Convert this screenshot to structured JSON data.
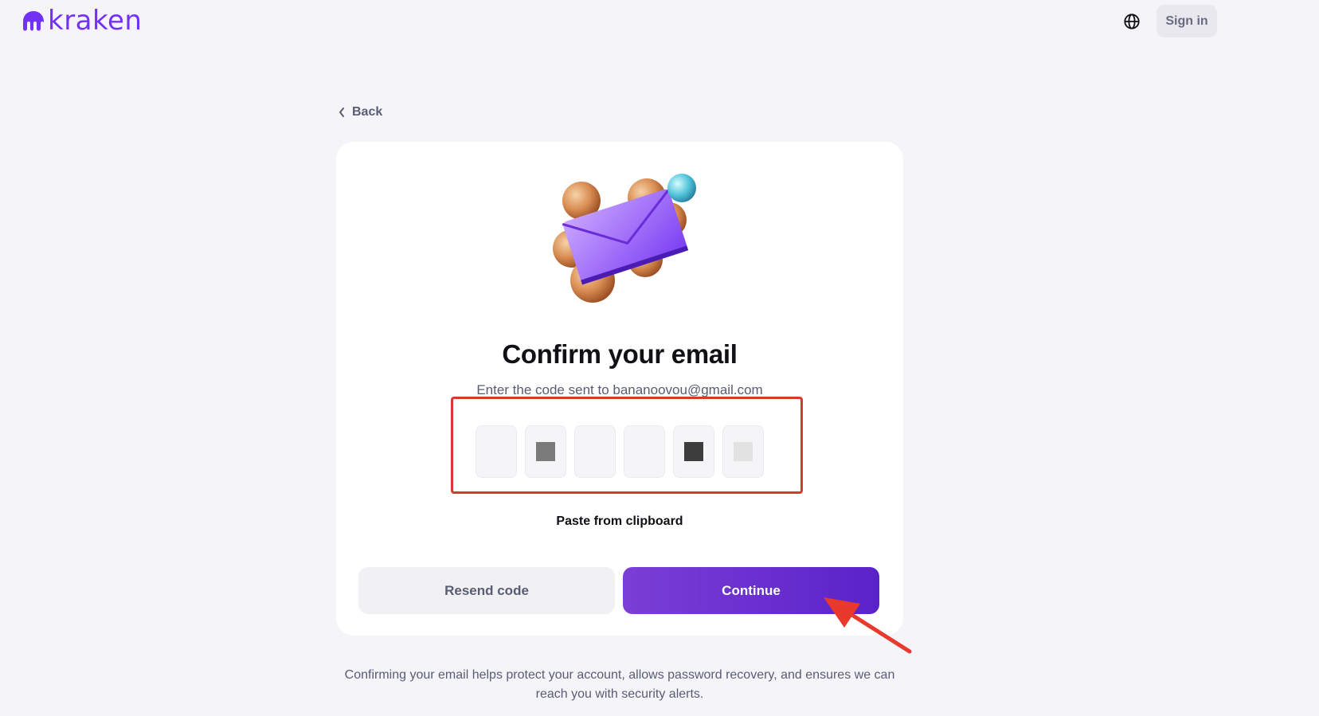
{
  "header": {
    "logo_text": "kraken",
    "logo_icon": "kraken-logo-icon",
    "globe_icon": "globe-icon",
    "sign_in_label": "Sign in"
  },
  "back": {
    "label": "Back",
    "icon": "chevron-left-icon"
  },
  "card": {
    "illustration": "envelope-illustration",
    "title": "Confirm your email",
    "subtitle": "Enter the code sent to bananoovou@gmail.com",
    "otp_length": 6,
    "paste_label": "Paste from clipboard",
    "resend_label": "Resend code",
    "continue_label": "Continue"
  },
  "footer": {
    "note": "Confirming your email helps protect your account, allows password recovery, and ensures we can reach you with security alerts."
  },
  "colors": {
    "brand": "#7132f5",
    "continue_start": "#7b3ed6",
    "continue_end": "#5a22c9",
    "highlight": "#d9382c"
  }
}
